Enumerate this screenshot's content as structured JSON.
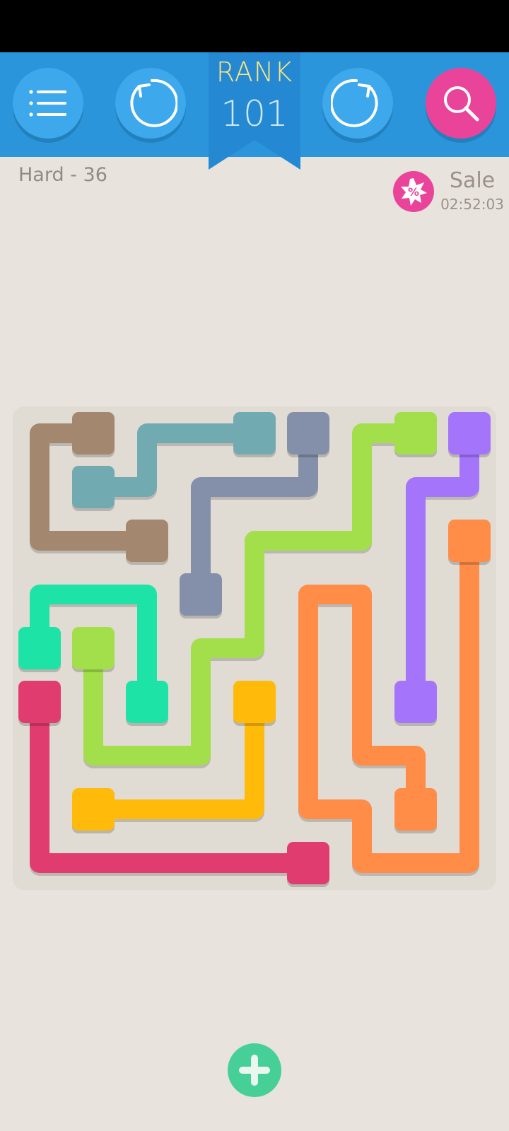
{
  "header": {
    "menu_icon": "menu-lines-icon",
    "undo_icon": "undo-arrow-icon",
    "restart_icon": "restart-arrow-icon",
    "hint_icon": "search-icon",
    "rank_label": "RANK",
    "rank_value": "101"
  },
  "level": {
    "label": "Hard - 36"
  },
  "sale": {
    "icon": "sale-badge-icon",
    "label": "Sale",
    "timer": "02:52:03"
  },
  "board": {
    "grid_size": 9,
    "flows": [
      {
        "id": "brown",
        "color": "#a4876f",
        "endpoints": [
          [
            1,
            0
          ],
          [
            2,
            2
          ]
        ],
        "path": [
          [
            1,
            0
          ],
          [
            0,
            0
          ],
          [
            0,
            2
          ],
          [
            2,
            2
          ]
        ]
      },
      {
        "id": "teal",
        "color": "#72aab2",
        "endpoints": [
          [
            4,
            0
          ],
          [
            1,
            1
          ]
        ],
        "path": [
          [
            4,
            0
          ],
          [
            2,
            0
          ],
          [
            2,
            1
          ],
          [
            1,
            1
          ]
        ]
      },
      {
        "id": "slate",
        "color": "#8490aa",
        "endpoints": [
          [
            5,
            0
          ],
          [
            3,
            3
          ]
        ],
        "path": [
          [
            5,
            0
          ],
          [
            5,
            1
          ],
          [
            3,
            1
          ],
          [
            3,
            3
          ]
        ]
      },
      {
        "id": "lime",
        "color": "#a3df4b",
        "endpoints": [
          [
            7,
            0
          ],
          [
            1,
            4
          ]
        ],
        "path": [
          [
            7,
            0
          ],
          [
            6,
            0
          ],
          [
            6,
            2
          ],
          [
            4,
            2
          ],
          [
            4,
            4
          ],
          [
            3,
            4
          ],
          [
            3,
            6
          ],
          [
            1,
            6
          ],
          [
            1,
            4
          ]
        ]
      },
      {
        "id": "purple",
        "color": "#a475fa",
        "endpoints": [
          [
            8,
            0
          ],
          [
            7,
            5
          ]
        ],
        "path": [
          [
            8,
            0
          ],
          [
            8,
            1
          ],
          [
            7,
            1
          ],
          [
            7,
            5
          ]
        ]
      },
      {
        "id": "orange",
        "color": "#ff8c47",
        "endpoints": [
          [
            8,
            2
          ],
          [
            7,
            7
          ]
        ],
        "path": [
          [
            8,
            2
          ],
          [
            8,
            8
          ],
          [
            6,
            8
          ],
          [
            6,
            7
          ],
          [
            5,
            7
          ],
          [
            5,
            3
          ],
          [
            6,
            3
          ],
          [
            6,
            6
          ],
          [
            7,
            6
          ],
          [
            7,
            7
          ]
        ]
      },
      {
        "id": "mint",
        "color": "#1ee3a6",
        "endpoints": [
          [
            0,
            4
          ],
          [
            2,
            5
          ]
        ],
        "path": [
          [
            0,
            4
          ],
          [
            0,
            3
          ],
          [
            2,
            3
          ],
          [
            2,
            5
          ]
        ]
      },
      {
        "id": "yellow",
        "color": "#ffba0a",
        "endpoints": [
          [
            4,
            5
          ],
          [
            1,
            7
          ]
        ],
        "path": [
          [
            4,
            5
          ],
          [
            4,
            7
          ],
          [
            1,
            7
          ]
        ]
      },
      {
        "id": "magenta",
        "color": "#e03c70",
        "endpoints": [
          [
            0,
            5
          ],
          [
            5,
            8
          ]
        ],
        "path": [
          [
            0,
            5
          ],
          [
            0,
            8
          ],
          [
            5,
            8
          ]
        ]
      }
    ]
  },
  "footer": {
    "add_icon": "plus-icon"
  },
  "colors": {
    "top_bar": "#2b95dc",
    "button": "#3ea8ec",
    "hint_button": "#e9449a",
    "background": "#e8e3dc",
    "board": "#e0dbd3",
    "add_button": "#47cf98"
  }
}
